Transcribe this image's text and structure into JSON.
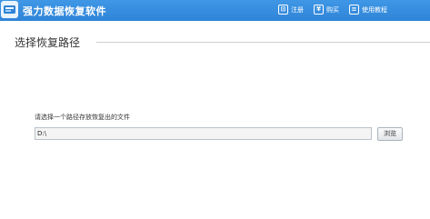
{
  "app": {
    "title": "强力数据恢复软件"
  },
  "menu": {
    "items": [
      {
        "label": "注册",
        "icon": "register-icon"
      },
      {
        "label": "购买",
        "icon": "cart-icon"
      },
      {
        "label": "使用教程",
        "icon": "help-book-icon"
      }
    ]
  },
  "section": {
    "title": "选择恢复路径"
  },
  "path_picker": {
    "prompt": "请选择一个路径存放恢复出的文件",
    "value": "D:\\",
    "browse_label": "浏览"
  },
  "colors": {
    "titlebar": "#3a90e0",
    "background": "#ffffff"
  }
}
